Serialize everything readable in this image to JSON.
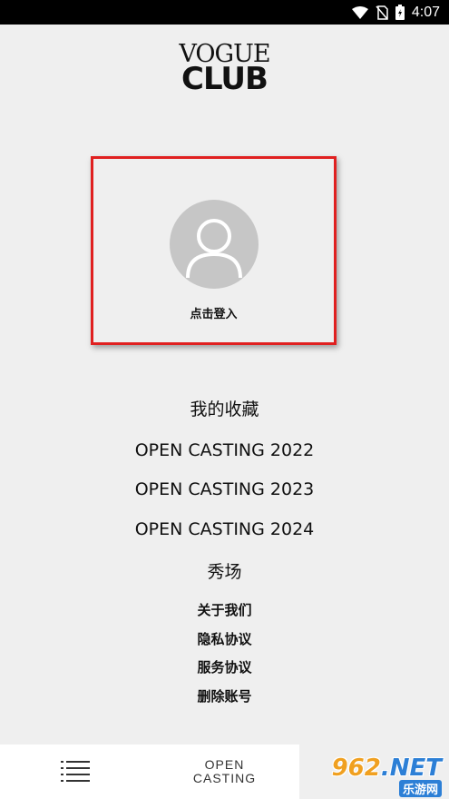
{
  "status_bar": {
    "time": "4:07"
  },
  "logo": {
    "line1": "VOGUE",
    "line2": "CLUB"
  },
  "login": {
    "label": "点击登入"
  },
  "menu": {
    "favorites": "我的收藏",
    "open_casting_2022": "OPEN CASTING 2022",
    "open_casting_2023": "OPEN CASTING 2023",
    "open_casting_2024": "OPEN CASTING 2024",
    "show": "秀场",
    "about": "关于我们",
    "privacy": "隐私协议",
    "service": "服务协议",
    "delete_account": "删除账号"
  },
  "bottom_nav": {
    "tabs": [
      {
        "icon": "list-icon"
      },
      {
        "logo_line1": "OPEN",
        "logo_line2": "CASTING"
      },
      {
        "icon": "profile-tab",
        "active": true
      }
    ]
  },
  "watermark": {
    "main": "962",
    "suffix": ".NET",
    "sub": "乐游网"
  },
  "colors": {
    "highlight_border": "#e02020",
    "avatar_bg": "#c6c6c6",
    "page_bg": "#efefef"
  }
}
